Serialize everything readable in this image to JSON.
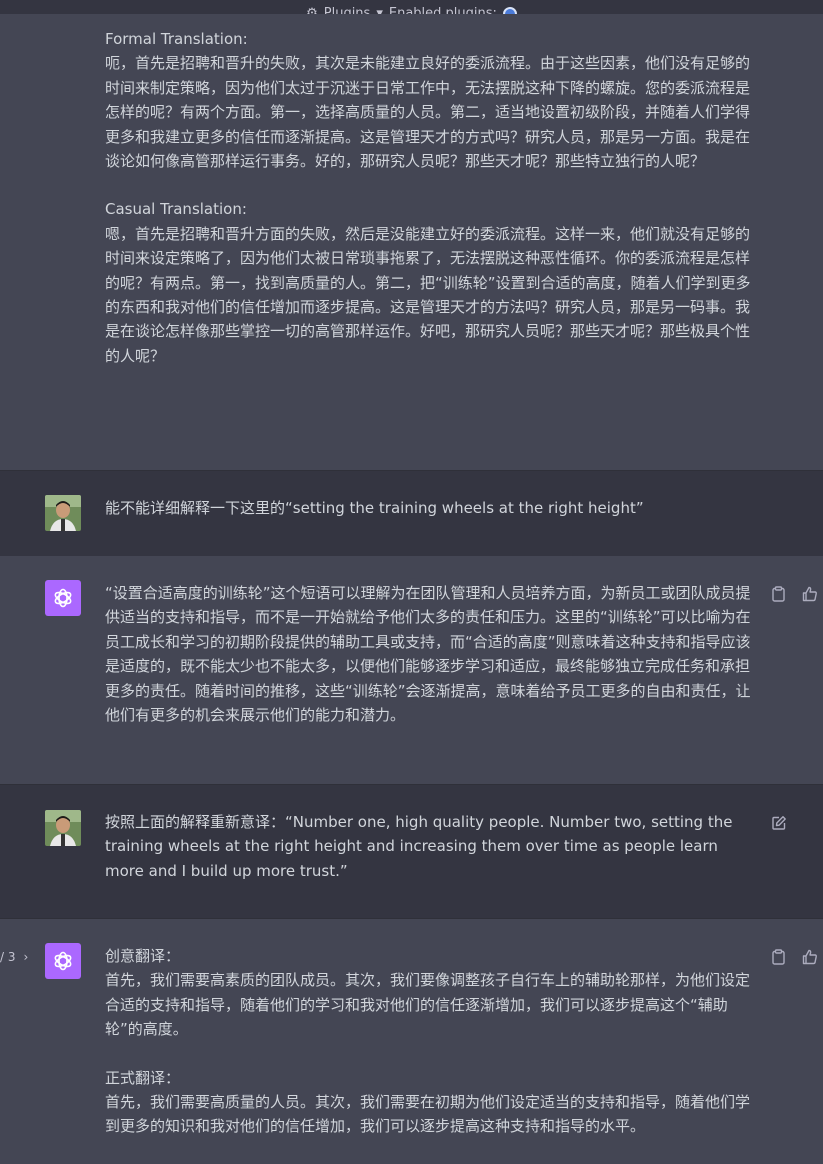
{
  "topbar": {
    "plugins_label": "Plugins",
    "enabled_label": "Enabled plugins:"
  },
  "messages": [
    {
      "role": "assistant",
      "paragraphs": [
        "Formal Translation:\n呃，首先是招聘和晋升的失败，其次是未能建立良好的委派流程。由于这些因素，他们没有足够的时间来制定策略，因为他们太过于沉迷于日常工作中，无法摆脱这种下降的螺旋。您的委派流程是怎样的呢？有两个方面。第一，选择高质量的人员。第二，适当地设置初级阶段，并随着人们学得更多和我建立更多的信任而逐渐提高。这是管理天才的方式吗？研究人员，那是另一方面。我是在谈论如何像高管那样运行事务。好的，那研究人员呢？那些天才呢？那些特立独行的人呢？",
        "Casual Translation:\n嗯，首先是招聘和晋升方面的失败，然后是没能建立好的委派流程。这样一来，他们就没有足够的时间来设定策略了，因为他们太被日常琐事拖累了，无法摆脱这种恶性循环。你的委派流程是怎样的呢？有两点。第一，找到高质量的人。第二，把“训练轮”设置到合适的高度，随着人们学到更多的东西和我对他们的信任增加而逐步提高。这是管理天才的方法吗？研究人员，那是另一码事。我是在谈论怎样像那些掌控一切的高管那样运作。好吧，那研究人员呢？那些天才呢？那些极具个性的人呢？"
      ]
    },
    {
      "role": "user",
      "text": "能不能详细解释一下这里的“setting the training wheels at the right height”"
    },
    {
      "role": "assistant",
      "paragraphs": [
        "“设置合适高度的训练轮”这个短语可以理解为在团队管理和人员培养方面，为新员工或团队成员提供适当的支持和指导，而不是一开始就给予他们太多的责任和压力。这里的“训练轮”可以比喻为在员工成长和学习的初期阶段提供的辅助工具或支持，而“合适的高度”则意味着这种支持和指导应该是适度的，既不能太少也不能太多，以便他们能够逐步学习和适应，最终能够独立完成任务和承担更多的责任。随着时间的推移，这些“训练轮”会逐渐提高，意味着给予员工更多的自由和责任，让他们有更多的机会来展示他们的能力和潜力。"
      ]
    },
    {
      "role": "user",
      "text": "按照上面的解释重新意译：“Number one, high quality people. Number two, setting the training wheels at the right height and increasing them over time as people learn more and I build up more trust.”"
    },
    {
      "role": "assistant",
      "pager": "/ 3",
      "paragraphs": [
        "创意翻译：\n首先，我们需要高素质的团队成员。其次，我们要像调整孩子自行车上的辅助轮那样，为他们设定合适的支持和指导，随着他们的学习和我对他们的信任逐渐增加，我们可以逐步提高这个“辅助轮”的高度。",
        "正式翻译：\n首先，我们需要高质量的人员。其次，我们需要在初期为他们设定适当的支持和指导，随着他们学到更多的知识和我对他们的信任增加，我们可以逐步提高这种支持和指导的水平。"
      ]
    }
  ],
  "icons": {
    "copy": "clipboard-icon",
    "thumbs_up": "thumbs-up-icon",
    "edit": "edit-icon",
    "chevron": "chevron-right-icon"
  },
  "colors": {
    "assistant_bg": "#444654",
    "user_bg": "#343541",
    "bot_avatar": "#ab68ff"
  }
}
